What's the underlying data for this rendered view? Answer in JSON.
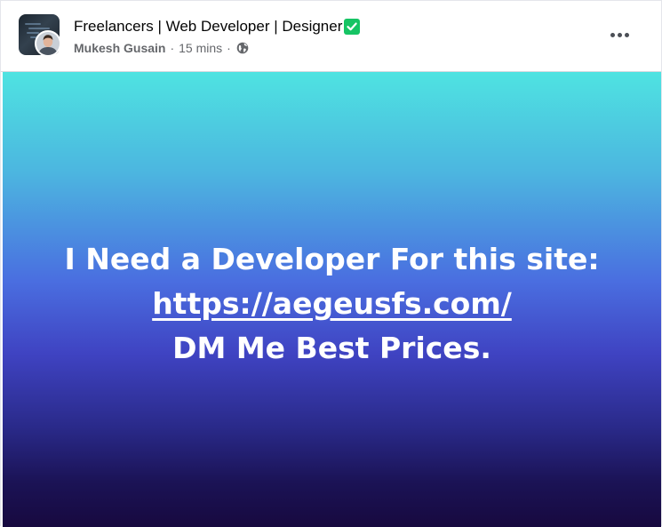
{
  "post": {
    "group_name": "Freelancers | Web Developer | Designer",
    "verified_icon": "check-box-icon",
    "author": "Mukesh Gusain",
    "separator": "·",
    "time_ago": "15 mins",
    "privacy_icon": "globe-icon",
    "more_icon": "more-options-icon",
    "body": {
      "line1": "I Need a Developer For this site:",
      "link": "https://aegeusfs.com/",
      "line3": "DM Me Best Prices."
    }
  },
  "colors": {
    "gradient_top": "#4ee3e1",
    "gradient_mid": "#4a6ee0",
    "gradient_bottom": "#17093f",
    "verified": "#16c464",
    "meta_text": "#65676b"
  }
}
